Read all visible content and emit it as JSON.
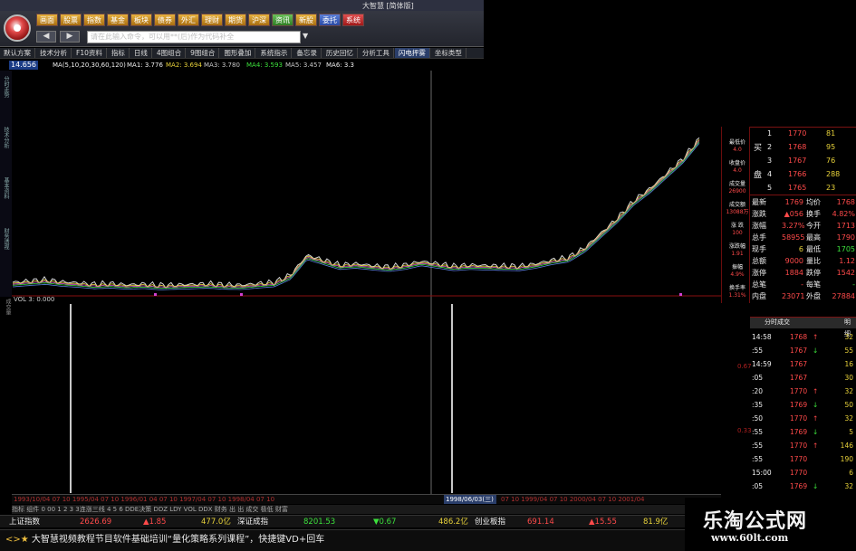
{
  "window": {
    "title": "大智慧 [简体版]",
    "logo_icon": "app-logo-icon"
  },
  "mainnav": [
    "画面",
    "股票",
    "指数",
    "基金",
    "板块",
    "债券",
    "外汇",
    "理财",
    "期货",
    "沪深",
    "资讯",
    "新股",
    "委托",
    "系统"
  ],
  "nav": {
    "back": "◀",
    "forward": "▶"
  },
  "command": {
    "placeholder": "请在此输入命令，可以用**(后)作为代码补全",
    "dropdown": "▼"
  },
  "toolbar": [
    "默认方案",
    "技术分析",
    "F10资料",
    "指标",
    "日线",
    "4图组合",
    "9图组合",
    "图形叠加",
    "系统指示",
    "备忘录",
    "历史回忆",
    "分析工具",
    "闪电抨雾",
    "坐标类型"
  ],
  "price_box": "14.656",
  "ma_row": {
    "label": "MA(5,10,20,30,60,120)",
    "ma1": "MA1: 3.776",
    "ma2": "MA2: 3.694",
    "ma3": "MA3: 3.780",
    "ma4": "MA4: 3.593",
    "ma5": "MA5: 3.457",
    "ma6": "MA6: 3.3"
  },
  "left_tabs": [
    "分时走势",
    "技术分析",
    "基本资料",
    "财务透视"
  ],
  "volume": {
    "label": "VOL  3: 0.000",
    "side": "成交量"
  },
  "quote_left": [
    "最低价",
    "收盘价",
    "成交量",
    "成交额",
    "涨 跌",
    "涨跌幅",
    "振幅",
    "换手率"
  ],
  "quote_left_vals": [
    "4.0",
    "4.0",
    "26900",
    "13088万",
    "100",
    "1.91",
    "4.9%",
    "1.31%"
  ],
  "orderbook": {
    "buy_label": "买",
    "sell_label": "盘",
    "rows": [
      {
        "n": "1",
        "p": "1770",
        "v": "81"
      },
      {
        "n": "2",
        "p": "1768",
        "v": "95"
      },
      {
        "n": "3",
        "p": "1767",
        "v": "76"
      },
      {
        "n": "4",
        "p": "1766",
        "v": "288"
      },
      {
        "n": "5",
        "p": "1765",
        "v": "23"
      }
    ]
  },
  "stats": [
    {
      "l": "最新",
      "v": "1769",
      "l2": "均价",
      "v2": "1768"
    },
    {
      "l": "涨跌",
      "v": "▲056",
      "l2": "换手",
      "v2": "4.82%"
    },
    {
      "l": "涨幅",
      "v": "3.27%",
      "l2": "今开",
      "v2": "1713"
    },
    {
      "l": "总手",
      "v": "58955",
      "l2": "最高",
      "v2": "1790"
    },
    {
      "l": "现手",
      "v": "6",
      "l2": "最低",
      "v2": "1705"
    },
    {
      "l": "总额",
      "v": "9000",
      "l2": "量比",
      "v2": "1.12"
    },
    {
      "l": "涨停",
      "v": "1884",
      "l2": "跌停",
      "v2": "1542"
    },
    {
      "l": "总笔",
      "v": "-",
      "l2": "每笔",
      "v2": "-"
    },
    {
      "l": "内盘",
      "v": "23071",
      "l2": "外盘",
      "v2": "27884"
    }
  ],
  "tick_head": {
    "a": "分时成交",
    "b": "明细"
  },
  "ticks": [
    {
      "t": "14:58",
      "p": "1768",
      "d": "↑",
      "v": "32"
    },
    {
      "t": ":55",
      "p": "1767",
      "d": "↓",
      "v": "55"
    },
    {
      "t": "14:59",
      "p": "1767",
      "d": "",
      "v": "16"
    },
    {
      "t": ":05",
      "p": "1767",
      "d": "",
      "v": "30"
    },
    {
      "t": ":20",
      "p": "1770",
      "d": "↑",
      "v": "32"
    },
    {
      "t": ":35",
      "p": "1769",
      "d": "↓",
      "v": "50"
    },
    {
      "t": ":50",
      "p": "1770",
      "d": "↑",
      "v": "32"
    },
    {
      "t": ":55",
      "p": "1769",
      "d": "↓",
      "v": "5"
    },
    {
      "t": ":55",
      "p": "1770",
      "d": "↑",
      "v": "146"
    },
    {
      "t": ":55",
      "p": "1770",
      "d": "",
      "v": "190"
    },
    {
      "t": "15:00",
      "p": "1770",
      "d": "",
      "v": "6"
    },
    {
      "t": ":05",
      "p": "1769",
      "d": "↓",
      "v": "32"
    }
  ],
  "right_scale": {
    "a": "0.67",
    "b": "0.33"
  },
  "date_axis": "1993/10/04  07  10  1995/04  07  10  1996/01  04  07  10  1997/04  07  10  1998/04  07  10",
  "date_selected": "1998/06/03(三)",
  "date_axis_tail": "07  10  1999/04  07  10  2000/04  07  10  2001/04",
  "tabrow": "指标  组件  0  00  1  2  3  3连涨三线  4  5  6  DDE决策  DDZ  LDY  VOL  DDX  财务  出  出  成交  极低  财富",
  "index_bar": [
    {
      "name": "上证指数",
      "val": "2626.69",
      "chg": "▲1.85",
      "amt": "477.0亿",
      "name2": "深证成指",
      "val2": "8201.53",
      "chg2": "▼0.67",
      "amt2": "486.2亿",
      "name3": "创业板指",
      "val3": "691.14",
      "chg3": "▲15.55",
      "amt3": "81.9亿"
    }
  ],
  "ticker": {
    "icons": "<>★",
    "text": "大智慧视频教程节目软件基础培训“量化策略系列课程”，快捷键VD+回车"
  },
  "watermark": {
    "line1": "乐淘公式网",
    "line2": "www.60lt.com"
  },
  "chart_data": {
    "type": "line",
    "title": "",
    "x_range_labels": [
      "1993/10/04",
      "1998/06/03",
      "2001/04"
    ],
    "y_range": [
      0,
      14.656
    ],
    "series": [
      {
        "name": "",
        "values": [
          3.2,
          3.25,
          3.3,
          3.22,
          3.18,
          3.12,
          3.15,
          3.1,
          3.13,
          3.08,
          3.1,
          3.12,
          3.14,
          3.1,
          3.09,
          3.15,
          3.2,
          3.5,
          4.3,
          4.1,
          3.9,
          3.95,
          3.88,
          3.82,
          3.9,
          4.05,
          3.95,
          3.85,
          3.9,
          3.88,
          3.86,
          3.85,
          3.95,
          4.1,
          4.2,
          4.6,
          5.2,
          5.8,
          6.5,
          7.0,
          7.6,
          8.2,
          9.0
        ]
      }
    ]
  }
}
